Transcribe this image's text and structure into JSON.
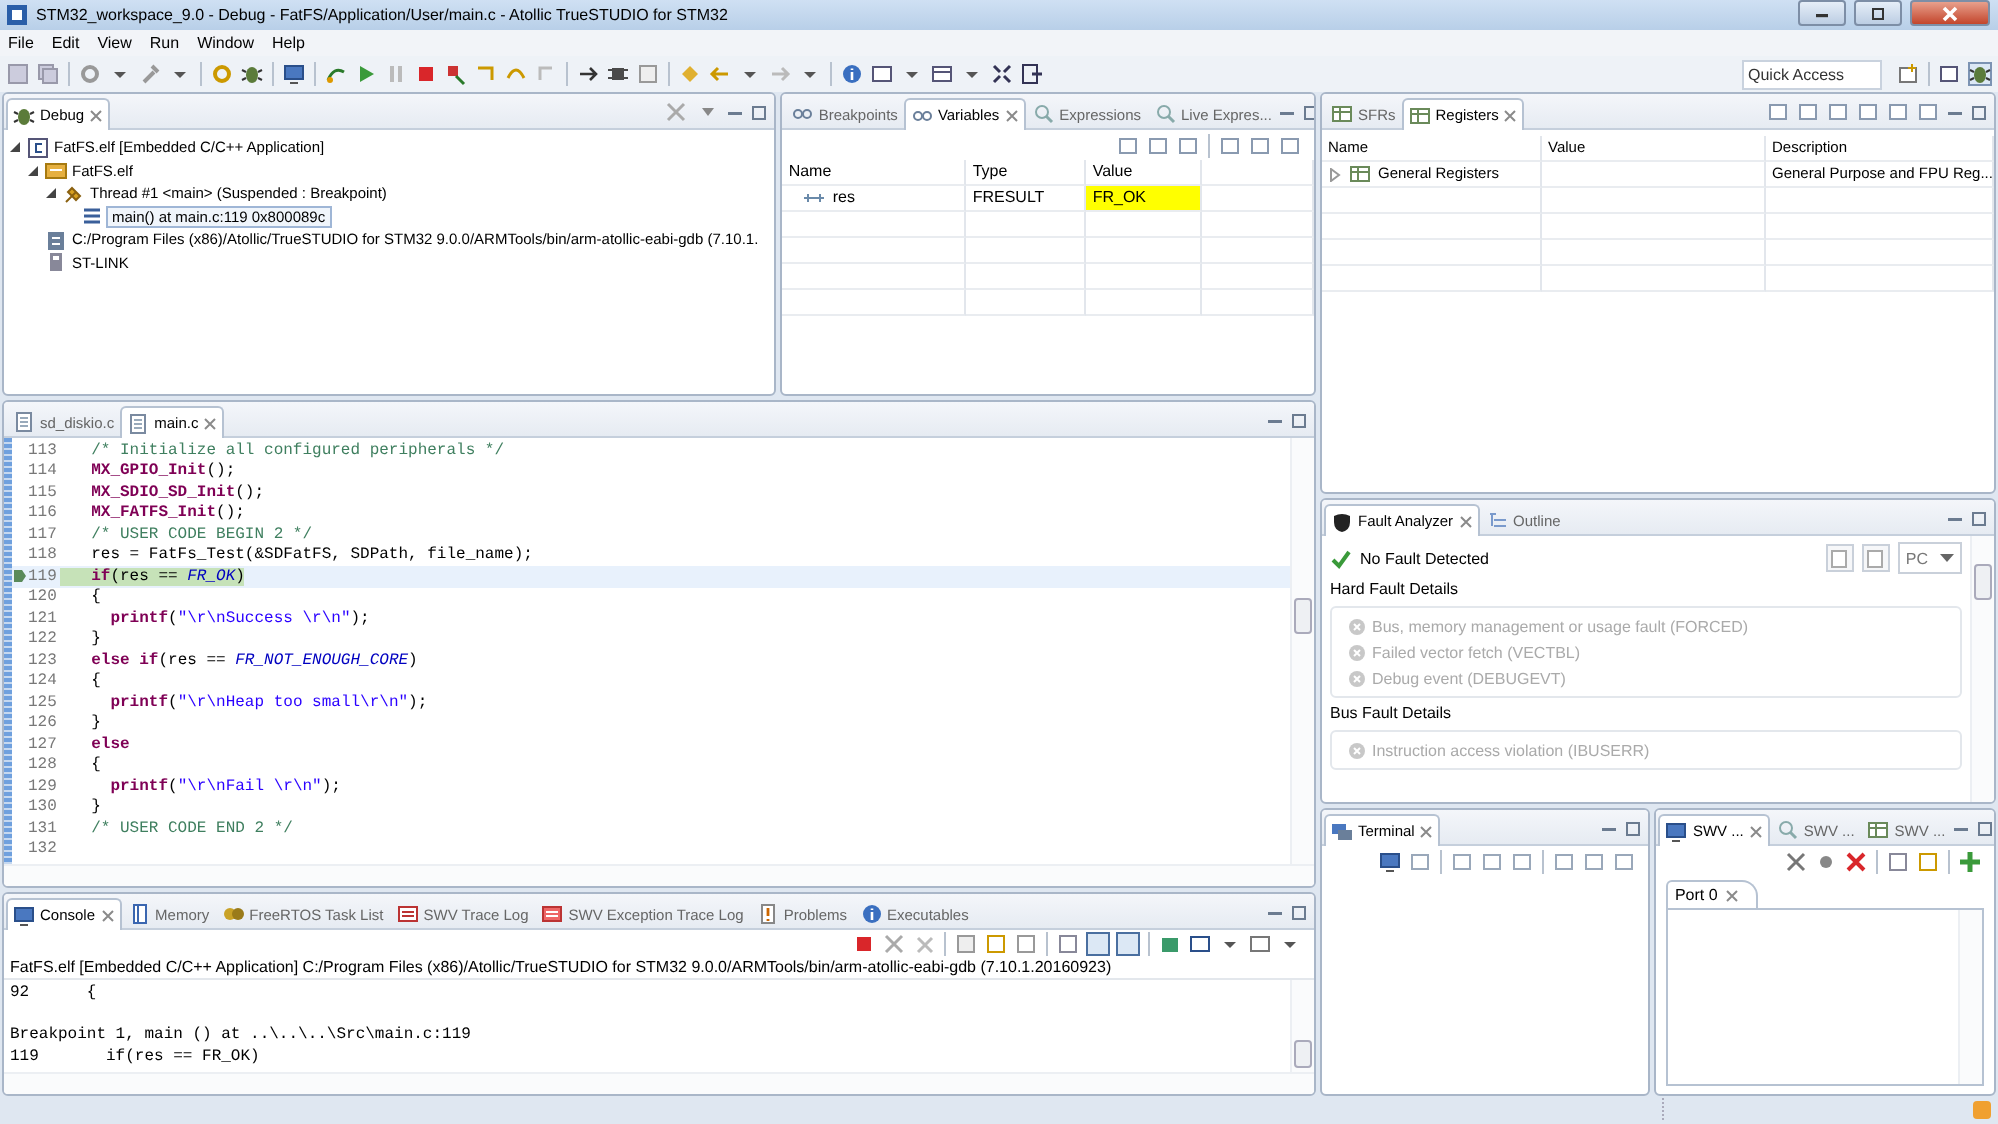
{
  "window": {
    "title": "STM32_workspace_9.0 - Debug - FatFS/Application/User/main.c - Atollic TrueSTUDIO for STM32"
  },
  "menu": [
    "File",
    "Edit",
    "View",
    "Run",
    "Window",
    "Help"
  ],
  "toolbar": {
    "quick_access_placeholder": "Quick Access"
  },
  "debug_view": {
    "tabs": [
      {
        "label": "Debug",
        "selected": true
      }
    ],
    "tree": [
      {
        "kind": "launch",
        "label": "FatFS.elf [Embedded C/C++ Application]",
        "expanded": true,
        "children": [
          {
            "kind": "process",
            "label": "FatFS.elf",
            "expanded": true,
            "children": [
              {
                "kind": "thread",
                "label": "Thread #1 <main> (Suspended : Breakpoint)",
                "expanded": true,
                "children": [
                  {
                    "kind": "frame",
                    "label": "main() at main.c:119 0x800089c",
                    "selected": true
                  }
                ]
              }
            ]
          },
          {
            "kind": "gdb",
            "label": "C:/Program Files (x86)/Atollic/TrueSTUDIO for STM32 9.0.0/ARMTools/bin/arm-atollic-eabi-gdb (7.10.1."
          },
          {
            "kind": "target",
            "label": "ST-LINK"
          }
        ]
      }
    ]
  },
  "variables_view": {
    "tabs": [
      {
        "label": "Breakpoints",
        "selected": false
      },
      {
        "label": "Variables",
        "selected": true
      },
      {
        "label": "Expressions",
        "selected": false
      },
      {
        "label": "Live Expres...",
        "selected": false
      }
    ],
    "columns": [
      "Name",
      "Type",
      "Value"
    ],
    "rows": [
      {
        "name": "res",
        "type": "FRESULT",
        "value": "FR_OK",
        "changed": true
      }
    ]
  },
  "registers_view": {
    "tabs": [
      {
        "label": "SFRs",
        "selected": false
      },
      {
        "label": "Registers",
        "selected": true
      }
    ],
    "columns": [
      "Name",
      "Value",
      "Description"
    ],
    "rows": [
      {
        "name": "General Registers",
        "description": "General Purpose and FPU Reg...",
        "expanded": false
      }
    ]
  },
  "editor": {
    "tabs": [
      {
        "label": "sd_diskio.c",
        "selected": false
      },
      {
        "label": "main.c",
        "selected": true
      }
    ],
    "lines": [
      {
        "number": "113",
        "current": false,
        "segments": [
          {
            "kind": "comment",
            "text": "  /* Initialize all configured peripherals */"
          }
        ]
      },
      {
        "number": "114",
        "current": false,
        "segments": [
          {
            "kind": "macro",
            "text": "  MX_GPIO_Init"
          },
          {
            "kind": "plain",
            "text": "();"
          }
        ]
      },
      {
        "number": "115",
        "current": false,
        "segments": [
          {
            "kind": "macro",
            "text": "  MX_SDIO_SD_Init"
          },
          {
            "kind": "plain",
            "text": "();"
          }
        ]
      },
      {
        "number": "116",
        "current": false,
        "segments": [
          {
            "kind": "macro",
            "text": "  MX_FATFS_Init"
          },
          {
            "kind": "plain",
            "text": "();"
          }
        ]
      },
      {
        "number": "117",
        "current": false,
        "segments": [
          {
            "kind": "comment",
            "text": "  /* USER CODE BEGIN 2 */"
          }
        ]
      },
      {
        "number": "118",
        "current": false,
        "segments": [
          {
            "kind": "plain",
            "text": "  res = FatFs_Test(&SDFatFS, SDPath, file_name);"
          }
        ]
      },
      {
        "number": "119",
        "current": true,
        "segments": [
          {
            "kind": "keyword",
            "text": "  if"
          },
          {
            "kind": "plain",
            "text": "(res == "
          },
          {
            "kind": "constant",
            "text": "FR_OK"
          },
          {
            "kind": "plain",
            "text": ")"
          }
        ]
      },
      {
        "number": "120",
        "current": false,
        "segments": [
          {
            "kind": "plain",
            "text": "  {"
          }
        ]
      },
      {
        "number": "121",
        "current": false,
        "segments": [
          {
            "kind": "macro",
            "text": "    printf"
          },
          {
            "kind": "plain",
            "text": "("
          },
          {
            "kind": "string",
            "text": "\"\\r\\nSuccess \\r\\n\""
          },
          {
            "kind": "plain",
            "text": ");"
          }
        ]
      },
      {
        "number": "122",
        "current": false,
        "segments": [
          {
            "kind": "plain",
            "text": "  }"
          }
        ]
      },
      {
        "number": "123",
        "current": false,
        "segments": [
          {
            "kind": "keyword",
            "text": "  else if"
          },
          {
            "kind": "plain",
            "text": "(res == "
          },
          {
            "kind": "constant",
            "text": "FR_NOT_ENOUGH_CORE"
          },
          {
            "kind": "plain",
            "text": ")"
          }
        ]
      },
      {
        "number": "124",
        "current": false,
        "segments": [
          {
            "kind": "plain",
            "text": "  {"
          }
        ]
      },
      {
        "number": "125",
        "current": false,
        "segments": [
          {
            "kind": "macro",
            "text": "    printf"
          },
          {
            "kind": "plain",
            "text": "("
          },
          {
            "kind": "string",
            "text": "\"\\r\\nHeap too small\\r\\n\""
          },
          {
            "kind": "plain",
            "text": ");"
          }
        ]
      },
      {
        "number": "126",
        "current": false,
        "segments": [
          {
            "kind": "plain",
            "text": "  }"
          }
        ]
      },
      {
        "number": "127",
        "current": false,
        "segments": [
          {
            "kind": "keyword",
            "text": "  else"
          }
        ]
      },
      {
        "number": "128",
        "current": false,
        "segments": [
          {
            "kind": "plain",
            "text": "  {"
          }
        ]
      },
      {
        "number": "129",
        "current": false,
        "segments": [
          {
            "kind": "macro",
            "text": "    printf"
          },
          {
            "kind": "plain",
            "text": "("
          },
          {
            "kind": "string",
            "text": "\"\\r\\nFail \\r\\n\""
          },
          {
            "kind": "plain",
            "text": ");"
          }
        ]
      },
      {
        "number": "130",
        "current": false,
        "segments": [
          {
            "kind": "plain",
            "text": "  }"
          }
        ]
      },
      {
        "number": "131",
        "current": false,
        "segments": [
          {
            "kind": "comment",
            "text": "  /* USER CODE END 2 */"
          }
        ]
      },
      {
        "number": "132",
        "current": false
      }
    ]
  },
  "console_view": {
    "tabs": [
      {
        "label": "Console",
        "selected": true
      },
      {
        "label": "Memory",
        "selected": false
      },
      {
        "label": "FreeRTOS Task List",
        "selected": false
      },
      {
        "label": "SWV Trace Log",
        "selected": false
      },
      {
        "label": "SWV Exception Trace Log",
        "selected": false
      },
      {
        "label": "Problems",
        "selected": false
      },
      {
        "label": "Executables",
        "selected": false
      }
    ],
    "process": "FatFS.elf [Embedded C/C++ Application] C:/Program Files (x86)/Atollic/TrueSTUDIO for STM32 9.0.0/ARMTools/bin/arm-atollic-eabi-gdb (7.10.1.20160923)",
    "lines": [
      {
        "text": "92      {",
        "blank_before": false
      },
      {
        "text": "Breakpoint 1, main () at ..\\..\\..\\Src\\main.c:119",
        "blank_before": true
      },
      {
        "text": "119       if(res == FR_OK)",
        "blank_before": false
      }
    ]
  },
  "fault_analyzer": {
    "tabs": [
      {
        "label": "Fault Analyzer",
        "selected": true
      },
      {
        "label": "Outline",
        "selected": false
      }
    ],
    "status": "No Fault Detected",
    "register_select": "PC",
    "groups": [
      {
        "title": "Hard Fault Details",
        "items": [
          {
            "text": "Bus, memory management or usage fault (FORCED)",
            "detected": false
          },
          {
            "text": "Failed vector fetch (VECTBL)",
            "detected": false
          },
          {
            "text": "Debug event (DEBUGEVT)",
            "detected": false
          }
        ]
      },
      {
        "title": "Bus Fault Details",
        "items": [
          {
            "text": "Instruction access violation (IBUSERR)",
            "detected": false
          }
        ]
      }
    ]
  },
  "terminal_view": {
    "tabs": [
      {
        "label": "Terminal",
        "selected": true
      }
    ]
  },
  "swv_view": {
    "tabs": [
      {
        "label": "SWV ...",
        "selected": true
      },
      {
        "label": "SWV ...",
        "selected": false
      },
      {
        "label": "SWV ...",
        "selected": false
      }
    ],
    "port_tabs": [
      {
        "label": "Port 0",
        "selected": true
      }
    ]
  }
}
